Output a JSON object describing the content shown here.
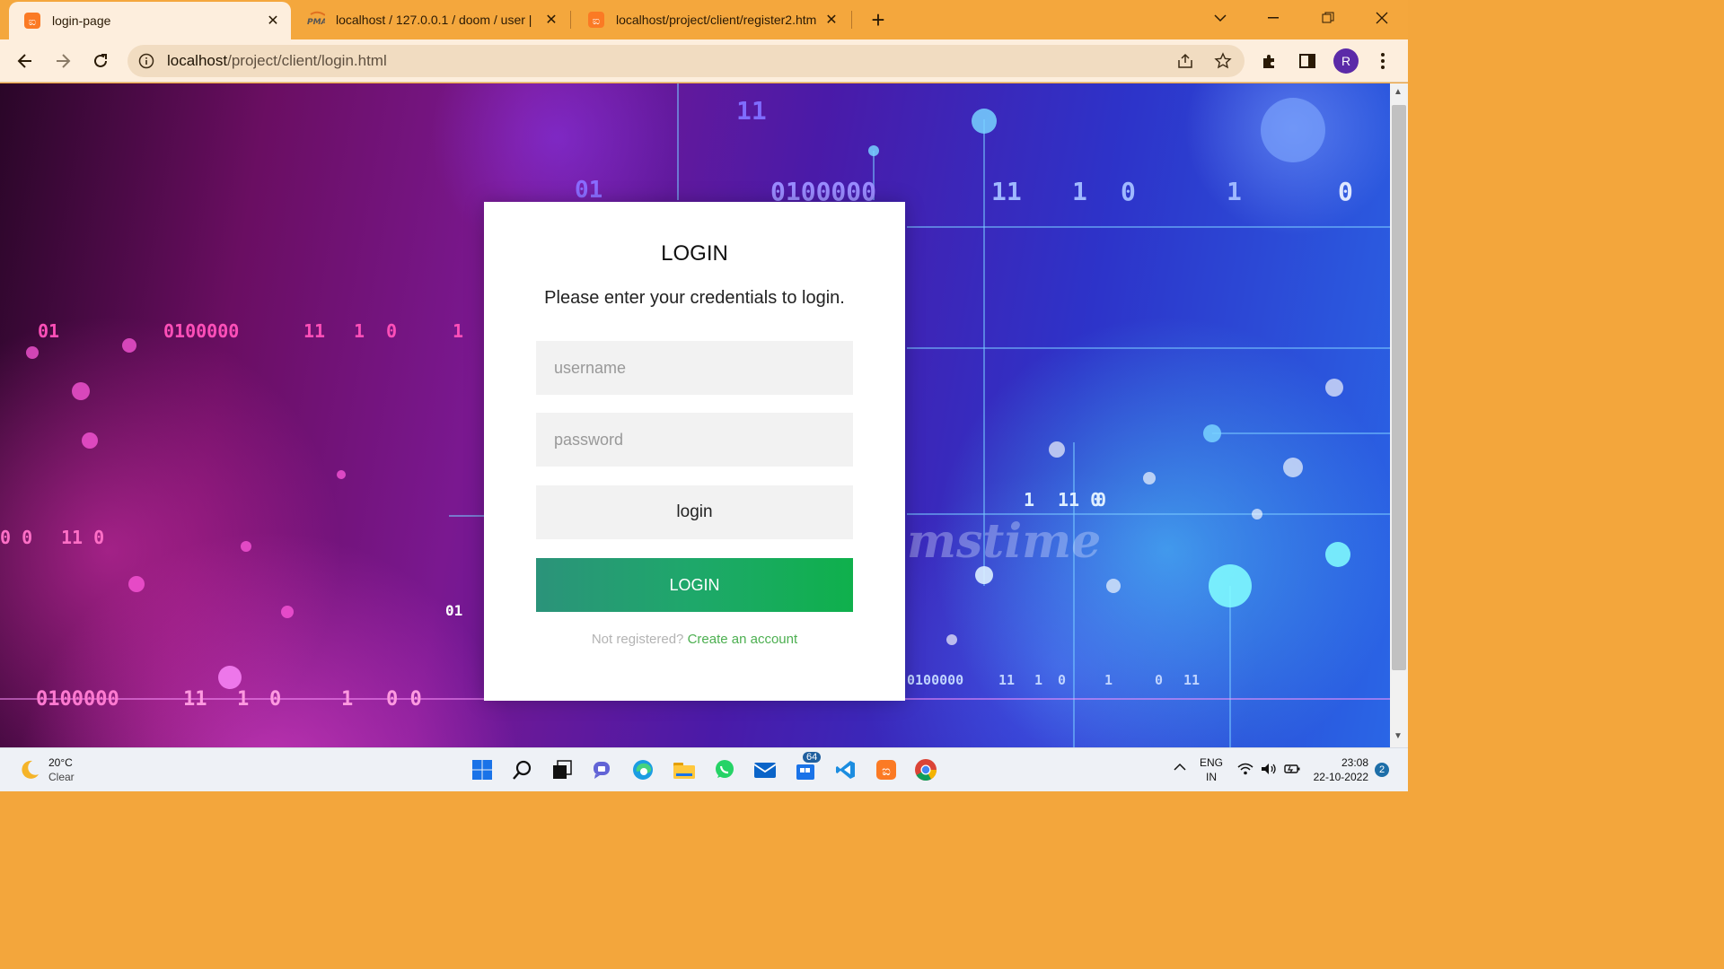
{
  "browser": {
    "tabs": [
      {
        "title": "login-page",
        "icon": "xampp-icon",
        "active": true
      },
      {
        "title": "localhost / 127.0.0.1 / doom / user |",
        "icon": "phpmyadmin-icon",
        "active": false
      },
      {
        "title": "localhost/project/client/register2.htm",
        "icon": "xampp-icon",
        "active": false
      }
    ],
    "url_host": "localhost",
    "url_path": "/project/client/login.html",
    "profile_initial": "R"
  },
  "background": {
    "binary_texts": [
      "01",
      "0100000",
      "11",
      "1",
      "0",
      "1",
      "0 0",
      "11 0",
      "01",
      "0100000",
      "11",
      "1",
      "0",
      "1",
      "0 0",
      "11",
      "0100000",
      "11",
      "1",
      "0",
      "1",
      "0",
      "11 0",
      "11",
      "1",
      "0",
      "1",
      "0",
      "0100000",
      "01",
      "11",
      "1",
      "0",
      "mstime"
    ]
  },
  "login": {
    "heading": "LOGIN",
    "subtitle": "Please enter your credentials to login.",
    "username_placeholder": "username",
    "password_placeholder": "password",
    "secondary_button": "login",
    "primary_button": "LOGIN",
    "not_registered": "Not registered?",
    "create_account": "Create an account"
  },
  "taskbar": {
    "weather_temp": "20°C",
    "weather_desc": "Clear",
    "mail_badge": "64",
    "lang": "ENG",
    "region": "IN",
    "time": "23:08",
    "date": "22-10-2022",
    "notification_count": "2"
  },
  "colors": {
    "chrome_accent": "#f4a73d",
    "login_green": "#1ea86a",
    "link_green": "#4caf50"
  }
}
